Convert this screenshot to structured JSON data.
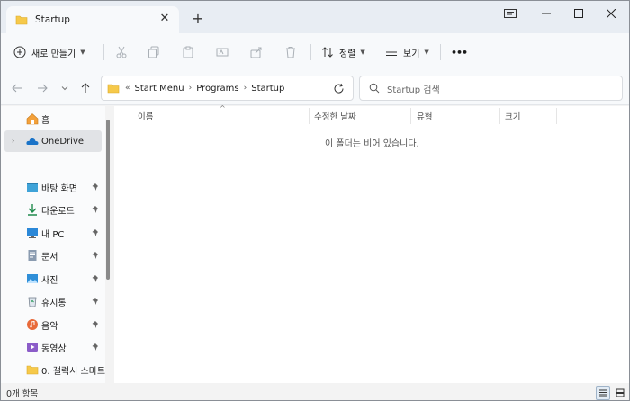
{
  "window": {
    "tab_title": "Startup",
    "tab_close": "✕",
    "new_tab": "+"
  },
  "toolbar": {
    "new_label": "새로 만들기",
    "sort_label": "정렬",
    "view_label": "보기",
    "more_label": "•••"
  },
  "address": {
    "overflow": "«",
    "breadcrumbs": [
      "Start Menu",
      "Programs",
      "Startup"
    ],
    "search_placeholder": "Startup 검색"
  },
  "sidebar": {
    "home": "홈",
    "onedrive": "OneDrive",
    "items": [
      {
        "label": "바탕 화면",
        "icon": "desktop-icon"
      },
      {
        "label": "다운로드",
        "icon": "download-icon"
      },
      {
        "label": "내 PC",
        "icon": "pc-icon"
      },
      {
        "label": "문서",
        "icon": "documents-icon"
      },
      {
        "label": "사진",
        "icon": "pictures-icon"
      },
      {
        "label": "휴지통",
        "icon": "recycle-bin-icon"
      },
      {
        "label": "음악",
        "icon": "music-icon"
      },
      {
        "label": "동영상",
        "icon": "videos-icon"
      },
      {
        "label": "0. 갤럭시 스마트",
        "icon": "folder-icon"
      }
    ]
  },
  "columns": {
    "name": "이름",
    "modified": "수정한 날짜",
    "type": "유형",
    "size": "크기"
  },
  "main": {
    "empty_message": "이 폴더는 비어 있습니다."
  },
  "status": {
    "item_count": "0개 항목"
  },
  "colors": {
    "folder": "#f6c94a",
    "onedrive": "#1a73c8",
    "accent": "#0067c0"
  }
}
